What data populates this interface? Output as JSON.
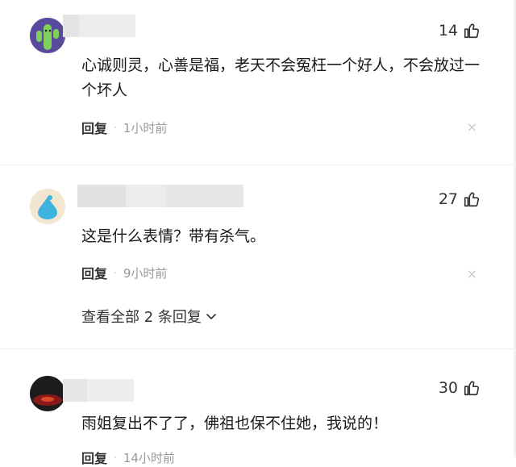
{
  "comments": [
    {
      "likes": "14",
      "text": "心诚则灵，心善是福，老天不会冤枉一个好人，不会放过一个坏人",
      "reply_label": "回复",
      "time": "1小时前",
      "close_glyph": "×"
    },
    {
      "likes": "27",
      "text": "这是什么表情？带有杀气。",
      "reply_label": "回复",
      "time": "9小时前",
      "close_glyph": "×",
      "expand_label": "查看全部 2 条回复"
    },
    {
      "likes": "30",
      "text": "雨姐复出不了了，佛祖也保不住她，我说的！",
      "reply_label": "回复",
      "time": "14小时前"
    }
  ],
  "icons": {
    "thumb_up": "thumbs-up-icon",
    "chevron": "chevron-down-icon",
    "close": "close-icon"
  },
  "colors": {
    "accent_text": "#222222",
    "meta_gray": "#999999",
    "blur_gray": "#d6d6d6"
  }
}
